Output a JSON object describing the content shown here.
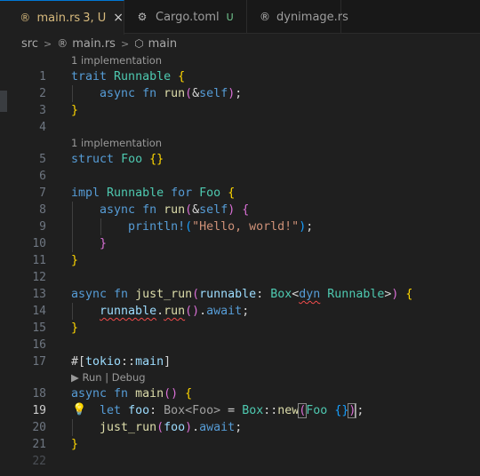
{
  "tabs": [
    {
      "icon": "rust-file-icon",
      "glyph": "®",
      "label": "main.rs",
      "status": "3, U",
      "close": "×",
      "active": true
    },
    {
      "icon": "gear-icon",
      "glyph": "⚙",
      "label": "Cargo.toml",
      "modified": "U",
      "active": false
    },
    {
      "icon": "rust-file-icon",
      "glyph": "®",
      "label": "dynimage.rs",
      "active": false
    }
  ],
  "breadcrumb": {
    "src": "src",
    "file": "main.rs",
    "symbol": "main",
    "separator": ">",
    "file_glyph": "®",
    "symbol_glyph": "⬡"
  },
  "codelens": {
    "implementations": "1 implementation",
    "run_debug": "▶ Run | Debug"
  },
  "line_numbers": [
    "1",
    "2",
    "3",
    "4",
    "5",
    "6",
    "7",
    "8",
    "9",
    "10",
    "11",
    "12",
    "13",
    "14",
    "15",
    "16",
    "17",
    "18",
    "19",
    "20",
    "21",
    "22"
  ],
  "current_line": "19",
  "code": {
    "l1": {
      "a": "trait",
      "b": "Runnable",
      "c": "{"
    },
    "l2": {
      "a": "async",
      "b": "fn",
      "c": "run",
      "d": "(",
      "e": "&",
      "f": "self",
      "g": ")",
      "h": ";"
    },
    "l3": {
      "a": "}"
    },
    "l5": {
      "a": "struct",
      "b": "Foo",
      "c": "{}"
    },
    "l7": {
      "a": "impl",
      "b": "Runnable",
      "c": "for",
      "d": "Foo",
      "e": "{"
    },
    "l8": {
      "a": "async",
      "b": "fn",
      "c": "run",
      "d": "(",
      "e": "&",
      "f": "self",
      "g": ")",
      "h": "{"
    },
    "l9": {
      "a": "println!",
      "b": "(",
      "c": "\"Hello, world!\"",
      "d": ")",
      "e": ";"
    },
    "l10": {
      "a": "}"
    },
    "l11": {
      "a": "}"
    },
    "l13": {
      "a": "async",
      "b": "fn",
      "c": "just_run",
      "d": "(",
      "e": "runnable",
      "f": ": ",
      "g": "Box",
      "h": "<",
      "i": "dyn",
      "j": "Runnable",
      "k": ">",
      "l": ")",
      "m": "{"
    },
    "l14": {
      "a": "runnable",
      "b": ".",
      "c": "run",
      "d": "()",
      "e": ".",
      "f": "await",
      "g": ";"
    },
    "l15": {
      "a": "}"
    },
    "l17": {
      "a": "#[",
      "b": "tokio",
      "c": "::",
      "d": "main",
      "e": "]"
    },
    "l18": {
      "a": "async",
      "b": "fn",
      "c": "main",
      "d": "()",
      "e": "{"
    },
    "l19": {
      "a": "let",
      "b": "foo",
      "c": ": ",
      "d": "Box<Foo>",
      "e": " = ",
      "f": "Box",
      "g": "::",
      "h": "new",
      "i": "(",
      "j": "Foo",
      "k": "{}",
      "l": ")",
      "m": ";"
    },
    "l20": {
      "a": "just_run",
      "b": "(",
      "c": "foo",
      "d": ")",
      "e": ".",
      "f": "await",
      "g": ";"
    },
    "l21": {
      "a": "}"
    }
  },
  "colors": {
    "background": "#1f1f1f",
    "tab_bar": "#181818",
    "keyword": "#569cd6",
    "type": "#4ec9b0",
    "function": "#dcdcaa",
    "variable": "#9cdcfe",
    "string": "#ce9178",
    "bracket_1": "#ffd700",
    "bracket_2": "#da70d6",
    "bracket_3": "#179fff",
    "error_squiggle": "#f14c4c",
    "untracked": "#73c991",
    "modified_warning": "#d7ba7d"
  }
}
